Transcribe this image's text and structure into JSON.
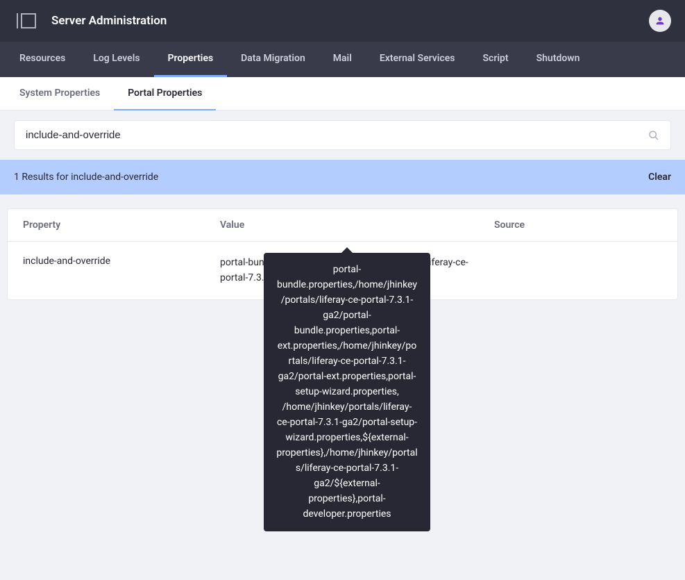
{
  "header": {
    "title": "Server Administration"
  },
  "nav_tabs": [
    {
      "label": "Resources",
      "active": false
    },
    {
      "label": "Log Levels",
      "active": false
    },
    {
      "label": "Properties",
      "active": true
    },
    {
      "label": "Data Migration",
      "active": false
    },
    {
      "label": "Mail",
      "active": false
    },
    {
      "label": "External Services",
      "active": false
    },
    {
      "label": "Script",
      "active": false
    },
    {
      "label": "Shutdown",
      "active": false
    }
  ],
  "sub_tabs": [
    {
      "label": "System Properties",
      "active": false
    },
    {
      "label": "Portal Properties",
      "active": true
    }
  ],
  "search": {
    "value": "include-and-override"
  },
  "results_bar": {
    "text": "1 Results for include-and-override",
    "clear": "Clear"
  },
  "table": {
    "headers": {
      "property": "Property",
      "value": "Value",
      "source": "Source"
    },
    "rows": [
      {
        "property": "include-and-override",
        "value": "portal-bundle.properties,/home/jhinkey/portals/liferay-ce-portal-7.3.1-ga2/po...",
        "source": ""
      }
    ]
  },
  "tooltip": {
    "text": "portal-bundle.properties,/home/jhinkey/portals/liferay-ce-portal-7.3.1-ga2/portal-bundle.properties,portal-ext.properties,/home/jhinkey/portals/liferay-ce-portal-7.3.1-ga2/portal-ext.properties,portal-setup-wizard.properties, /home/jhinkey/portals/liferay-ce-portal-7.3.1-ga2/portal-setup-wizard.properties,${external-properties},/home/jhinkey/portals/liferay-ce-portal-7.3.1-ga2/${external-properties},portal-developer.properties"
  }
}
